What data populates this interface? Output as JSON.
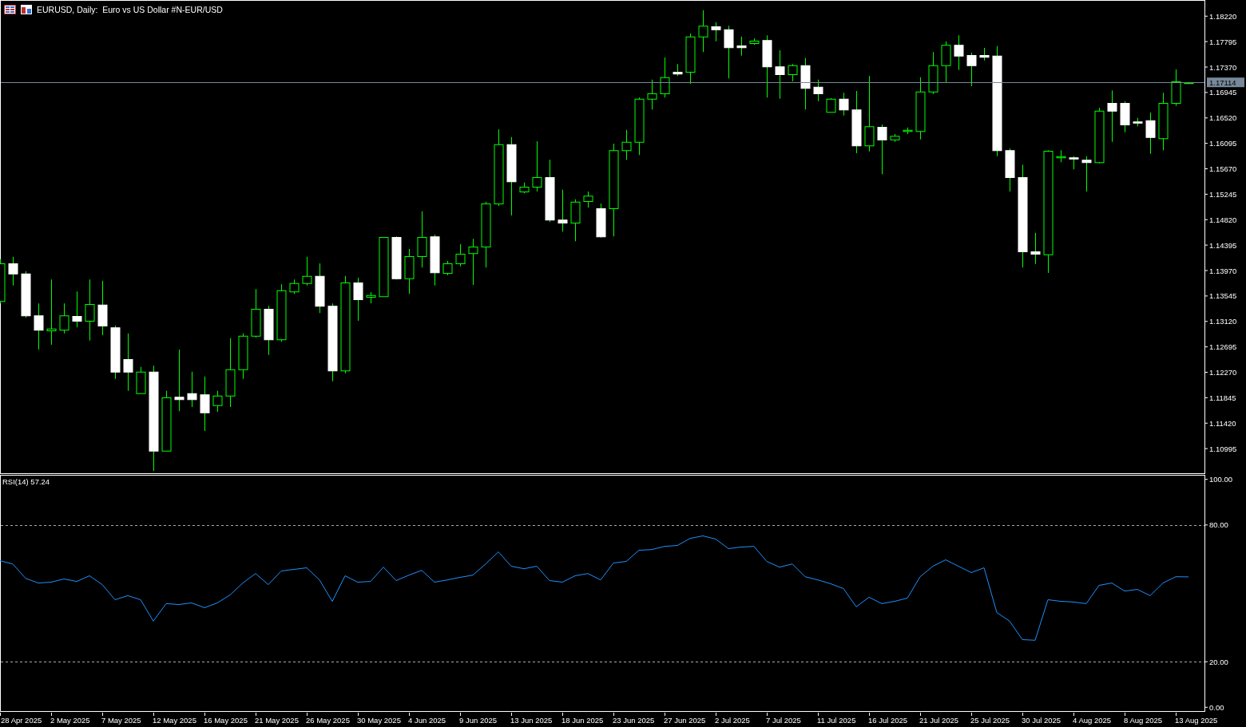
{
  "chart_window": {
    "title": "EURUSD, Daily:  Euro vs US Dollar #N-EUR/USD"
  },
  "price_chart": {
    "current_price": "1.17114",
    "chart_data": {
      "type": "candlestick",
      "ylim": [
        1.1057,
        1.1849
      ],
      "yticks": [
        {
          "value": 1.1822,
          "label": "1.18220"
        },
        {
          "value": 1.17795,
          "label": "1.17795"
        },
        {
          "value": 1.1737,
          "label": "1.17370"
        },
        {
          "value": 1.16945,
          "label": "1.16945"
        },
        {
          "value": 1.1652,
          "label": "1.16520"
        },
        {
          "value": 1.16095,
          "label": "1.16095"
        },
        {
          "value": 1.1567,
          "label": "1.15670"
        },
        {
          "value": 1.15245,
          "label": "1.15245"
        },
        {
          "value": 1.1482,
          "label": "1.14820"
        },
        {
          "value": 1.14395,
          "label": "1.14395"
        },
        {
          "value": 1.1397,
          "label": "1.13970"
        },
        {
          "value": 1.13545,
          "label": "1.13545"
        },
        {
          "value": 1.1312,
          "label": "1.13120"
        },
        {
          "value": 1.12695,
          "label": "1.12695"
        },
        {
          "value": 1.1227,
          "label": "1.12270"
        },
        {
          "value": 1.11845,
          "label": "1.11845"
        },
        {
          "value": 1.1142,
          "label": "1.11420"
        },
        {
          "value": 1.10995,
          "label": "1.10995"
        }
      ],
      "ohlc": [
        [
          1.1346,
          1.1416,
          1.1342,
          1.1409
        ],
        [
          1.1409,
          1.142,
          1.1372,
          1.1392
        ],
        [
          1.1392,
          1.1396,
          1.1318,
          1.1322
        ],
        [
          1.1322,
          1.1342,
          1.1265,
          1.1298
        ],
        [
          1.1297,
          1.1382,
          1.1273,
          1.13
        ],
        [
          1.1298,
          1.1342,
          1.1292,
          1.1322
        ],
        [
          1.1321,
          1.1362,
          1.1302,
          1.1313
        ],
        [
          1.1313,
          1.1382,
          1.128,
          1.1341
        ],
        [
          1.134,
          1.138,
          1.1289,
          1.1305
        ],
        [
          1.1302,
          1.1305,
          1.1216,
          1.1228
        ],
        [
          1.1249,
          1.1292,
          1.1196,
          1.1228
        ],
        [
          1.1192,
          1.1236,
          1.1192,
          1.1228
        ],
        [
          1.1228,
          1.1238,
          1.1062,
          1.1096
        ],
        [
          1.1096,
          1.1196,
          1.1096,
          1.1185
        ],
        [
          1.1186,
          1.1265,
          1.1162,
          1.1182
        ],
        [
          1.1192,
          1.1228,
          1.1169,
          1.1182
        ],
        [
          1.119,
          1.122,
          1.1129,
          1.116
        ],
        [
          1.1172,
          1.1196,
          1.1161,
          1.1188
        ],
        [
          1.1188,
          1.1284,
          1.1169,
          1.1232
        ],
        [
          1.1232,
          1.1292,
          1.1216,
          1.1288
        ],
        [
          1.1288,
          1.1366,
          1.1285,
          1.1333
        ],
        [
          1.1333,
          1.1338,
          1.1256,
          1.1282
        ],
        [
          1.1282,
          1.1374,
          1.1278,
          1.1364
        ],
        [
          1.1362,
          1.1382,
          1.1358,
          1.1376
        ],
        [
          1.1376,
          1.142,
          1.1372,
          1.1388
        ],
        [
          1.1388,
          1.1409,
          1.1326,
          1.1338
        ],
        [
          1.1338,
          1.1342,
          1.1212,
          1.123
        ],
        [
          1.123,
          1.1388,
          1.1225,
          1.1377
        ],
        [
          1.1377,
          1.1385,
          1.1313,
          1.1349
        ],
        [
          1.1353,
          1.1361,
          1.1342,
          1.1356
        ],
        [
          1.1354,
          1.1453,
          1.1354,
          1.1453
        ],
        [
          1.1453,
          1.1454,
          1.1382,
          1.1384
        ],
        [
          1.1384,
          1.1433,
          1.1358,
          1.1421
        ],
        [
          1.1421,
          1.1496,
          1.1402,
          1.1453
        ],
        [
          1.1454,
          1.1457,
          1.1372,
          1.1394
        ],
        [
          1.1393,
          1.1413,
          1.1389,
          1.1409
        ],
        [
          1.1409,
          1.1441,
          1.1404,
          1.1425
        ],
        [
          1.1426,
          1.145,
          1.1373,
          1.1437
        ],
        [
          1.1437,
          1.1512,
          1.1402,
          1.1509
        ],
        [
          1.1509,
          1.1633,
          1.1505,
          1.1608
        ],
        [
          1.1608,
          1.162,
          1.1489,
          1.1546
        ],
        [
          1.1529,
          1.1544,
          1.1526,
          1.1537
        ],
        [
          1.1537,
          1.1613,
          1.1529,
          1.1553
        ],
        [
          1.1553,
          1.1582,
          1.1478,
          1.1482
        ],
        [
          1.1482,
          1.1532,
          1.1462,
          1.1477
        ],
        [
          1.1477,
          1.1516,
          1.1446,
          1.1512
        ],
        [
          1.1513,
          1.1529,
          1.1502,
          1.1522
        ],
        [
          1.1501,
          1.1509,
          1.1452,
          1.1454
        ],
        [
          1.1501,
          1.1609,
          1.1454,
          1.1598
        ],
        [
          1.1598,
          1.1632,
          1.1582,
          1.1612
        ],
        [
          1.1612,
          1.1686,
          1.159,
          1.1684
        ],
        [
          1.1684,
          1.1716,
          1.1666,
          1.1693
        ],
        [
          1.1693,
          1.1753,
          1.1686,
          1.172
        ],
        [
          1.1729,
          1.1742,
          1.1722,
          1.1726
        ],
        [
          1.1729,
          1.1793,
          1.1709,
          1.1788
        ],
        [
          1.1788,
          1.1832,
          1.1762,
          1.1806
        ],
        [
          1.1805,
          1.1812,
          1.178,
          1.18
        ],
        [
          1.18,
          1.1806,
          1.1718,
          1.177
        ],
        [
          1.1773,
          1.1788,
          1.1756,
          1.177
        ],
        [
          1.1777,
          1.1785,
          1.1774,
          1.1781
        ],
        [
          1.1782,
          1.179,
          1.1686,
          1.1738
        ],
        [
          1.1738,
          1.1765,
          1.1684,
          1.1725
        ],
        [
          1.1725,
          1.1742,
          1.1713,
          1.174
        ],
        [
          1.174,
          1.1752,
          1.1666,
          1.1702
        ],
        [
          1.1704,
          1.1716,
          1.168,
          1.1693
        ],
        [
          1.1662,
          1.1685,
          1.1662,
          1.1684
        ],
        [
          1.1684,
          1.1694,
          1.1656,
          1.1666
        ],
        [
          1.1666,
          1.1697,
          1.1593,
          1.1606
        ],
        [
          1.1606,
          1.1722,
          1.1596,
          1.1638
        ],
        [
          1.1637,
          1.1641,
          1.1558,
          1.1616
        ],
        [
          1.1616,
          1.1625,
          1.1612,
          1.1622
        ],
        [
          1.163,
          1.1636,
          1.1625,
          1.1632
        ],
        [
          1.163,
          1.172,
          1.1616,
          1.1696
        ],
        [
          1.1696,
          1.1762,
          1.1692,
          1.174
        ],
        [
          1.174,
          1.178,
          1.1712,
          1.1774
        ],
        [
          1.1774,
          1.179,
          1.1732,
          1.1756
        ],
        [
          1.1757,
          1.1761,
          1.1705,
          1.174
        ],
        [
          1.1757,
          1.1769,
          1.1748,
          1.1754
        ],
        [
          1.1756,
          1.1772,
          1.1588,
          1.1598
        ],
        [
          1.1598,
          1.1601,
          1.1529,
          1.1553
        ],
        [
          1.1553,
          1.1574,
          1.1402,
          1.1429
        ],
        [
          1.1429,
          1.146,
          1.1408,
          1.1425
        ],
        [
          1.1424,
          1.1598,
          1.1393,
          1.1597
        ],
        [
          1.1586,
          1.1598,
          1.1578,
          1.1588
        ],
        [
          1.1586,
          1.1588,
          1.1566,
          1.1584
        ],
        [
          1.1582,
          1.1588,
          1.1529,
          1.1578
        ],
        [
          1.1578,
          1.1669,
          1.1576,
          1.1664
        ],
        [
          1.1677,
          1.1698,
          1.1612,
          1.1664
        ],
        [
          1.1677,
          1.168,
          1.1628,
          1.1641
        ],
        [
          1.1646,
          1.1652,
          1.1638,
          1.1644
        ],
        [
          1.1648,
          1.1661,
          1.1592,
          1.162
        ],
        [
          1.1618,
          1.1694,
          1.1598,
          1.1677
        ],
        [
          1.1677,
          1.1733,
          1.1672,
          1.1713
        ],
        [
          1.171,
          1.1712,
          1.1709,
          1.17114
        ]
      ]
    }
  },
  "rsi_panel": {
    "label": "RSI(14) 57.24",
    "chart_data": {
      "type": "line",
      "ylim": [
        -2,
        102
      ],
      "yticks": [
        {
          "value": 100,
          "label": "100.00"
        },
        {
          "value": 80,
          "label": "80.00"
        },
        {
          "value": 20,
          "label": "20.00"
        },
        {
          "value": 0,
          "label": "0.00"
        }
      ],
      "series": [
        {
          "color": "#1e90ff",
          "values": [
            64.3,
            62.9,
            56.6,
            54.5,
            54.9,
            56.3,
            55.2,
            57.7,
            53.8,
            47.2,
            49.0,
            47.2,
            37.8,
            45.5,
            45.1,
            45.8,
            43.7,
            45.8,
            49.3,
            54.5,
            58.7,
            53.8,
            59.8,
            60.5,
            61.2,
            55.9,
            46.5,
            57.7,
            54.9,
            55.2,
            61.5,
            55.6,
            58.0,
            60.1,
            54.9,
            55.9,
            57.0,
            58.0,
            62.9,
            68.2,
            61.9,
            60.8,
            61.9,
            55.6,
            54.9,
            57.7,
            58.7,
            55.9,
            63.3,
            64.0,
            68.9,
            69.2,
            70.6,
            71.0,
            74.1,
            75.2,
            73.8,
            69.6,
            70.3,
            70.6,
            64.0,
            61.5,
            62.9,
            57.3,
            55.9,
            54.2,
            52.1,
            44.1,
            48.3,
            45.5,
            46.5,
            47.9,
            57.3,
            61.9,
            64.7,
            61.9,
            59.1,
            61.2,
            41.6,
            37.8,
            29.7,
            29.4,
            47.2,
            46.5,
            46.2,
            45.5,
            53.5,
            54.5,
            51.0,
            51.7,
            49.0,
            54.5,
            57.3,
            57.2
          ]
        }
      ]
    }
  },
  "date_axis": {
    "labels": [
      "28 Apr 2025",
      "2 May 2025",
      "7 May 2025",
      "12 May 2025",
      "16 May 2025",
      "21 May 2025",
      "26 May 2025",
      "30 May 2025",
      "4 Jun 2025",
      "9 Jun 2025",
      "13 Jun 2025",
      "18 Jun 2025",
      "23 Jun 2025",
      "27 Jun 2025",
      "2 Jul 2025",
      "7 Jul 2025",
      "11 Jul 2025",
      "16 Jul 2025",
      "21 Jul 2025",
      "25 Jul 2025",
      "30 Jul 2025",
      "4 Aug 2025",
      "8 Aug 2025",
      "13 Aug 2025"
    ]
  }
}
